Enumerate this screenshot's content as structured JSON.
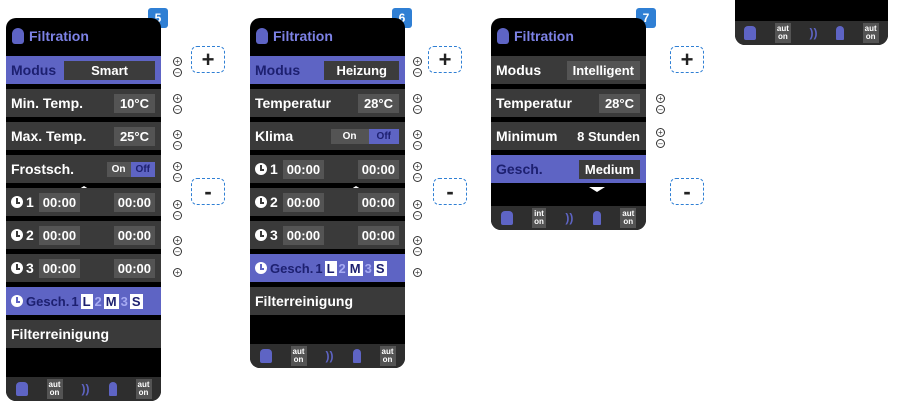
{
  "screens": [
    {
      "badge": "5",
      "title": "Filtration",
      "rows": [
        {
          "label": "Modus",
          "value": "Smart"
        },
        {
          "label": "Min. Temp.",
          "value": "10°C"
        },
        {
          "label": "Max. Temp.",
          "value": "25°C"
        },
        {
          "label": "Frostsch.",
          "toggle": [
            "On",
            "Off"
          ]
        },
        {
          "clock": "1",
          "from": "00:00",
          "to": "00:00"
        },
        {
          "clock": "2",
          "from": "00:00",
          "to": "00:00"
        },
        {
          "clock": "3",
          "from": "00:00",
          "to": "00:00"
        },
        {
          "gesch": "Gesch.",
          "speeds": [
            "1",
            "L",
            "2",
            "M",
            "3",
            "S"
          ]
        },
        {
          "label": "Filterreinigung"
        }
      ],
      "footer": {
        "badge1": [
          "aut",
          "on"
        ],
        "badge2": [
          "aut",
          "on"
        ]
      }
    },
    {
      "badge": "6",
      "title": "Filtration",
      "rows": [
        {
          "label": "Modus",
          "value": "Heizung"
        },
        {
          "label": "Temperatur",
          "value": "28°C"
        },
        {
          "label": "Klima",
          "toggle": [
            "On",
            "Off"
          ]
        },
        {
          "clock": "1",
          "from": "00:00",
          "to": "00:00"
        },
        {
          "clock": "2",
          "from": "00:00",
          "to": "00:00"
        },
        {
          "clock": "3",
          "from": "00:00",
          "to": "00:00"
        },
        {
          "gesch": "Gesch.",
          "speeds": [
            "1",
            "L",
            "2",
            "M",
            "3",
            "S"
          ]
        },
        {
          "label": "Filterreinigung"
        }
      ],
      "footer": {
        "badge1": [
          "aut",
          "on"
        ],
        "badge2": [
          "aut",
          "on"
        ]
      }
    },
    {
      "badge": "7",
      "title": "Filtration",
      "rows": [
        {
          "label": "Modus",
          "value": "Intelligent"
        },
        {
          "label": "Temperatur",
          "value": "28°C"
        },
        {
          "label": "Minimum",
          "value": "8 Stunden"
        },
        {
          "label": "Gesch.",
          "value": "Medium"
        }
      ],
      "footer": {
        "badge1": [
          "int",
          "on"
        ],
        "badge2": [
          "aut",
          "on"
        ]
      }
    }
  ],
  "mini_footer": {
    "badge1": [
      "aut",
      "on"
    ],
    "badge2": [
      "aut",
      "on"
    ]
  },
  "buttons": {
    "plus": "+",
    "minus": "-"
  },
  "colors": {
    "accent": "#5e64c4",
    "badge": "#2f7fd4",
    "row": "#3a3a3a"
  }
}
